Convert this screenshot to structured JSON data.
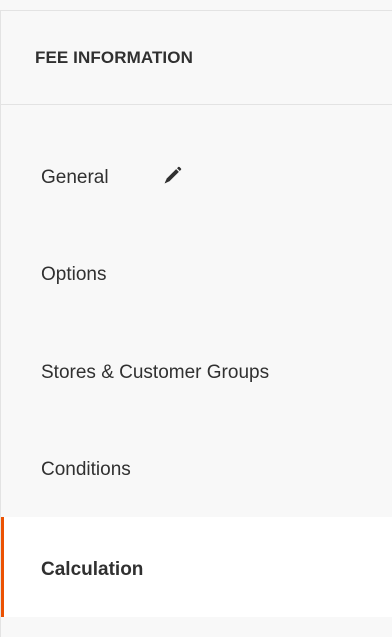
{
  "panel": {
    "title": "FEE INFORMATION"
  },
  "nav": {
    "items": [
      {
        "label": "General",
        "icon": "pencil-icon",
        "active": false
      },
      {
        "label": "Options",
        "active": false
      },
      {
        "label": "Stores & Customer Groups",
        "active": false
      },
      {
        "label": "Conditions",
        "active": false
      },
      {
        "label": "Calculation",
        "active": true
      }
    ]
  },
  "colors": {
    "accent": "#eb5202",
    "panel_bg": "#f8f8f8",
    "active_bg": "#ffffff",
    "text": "#303030",
    "border": "#e3e3e3"
  }
}
